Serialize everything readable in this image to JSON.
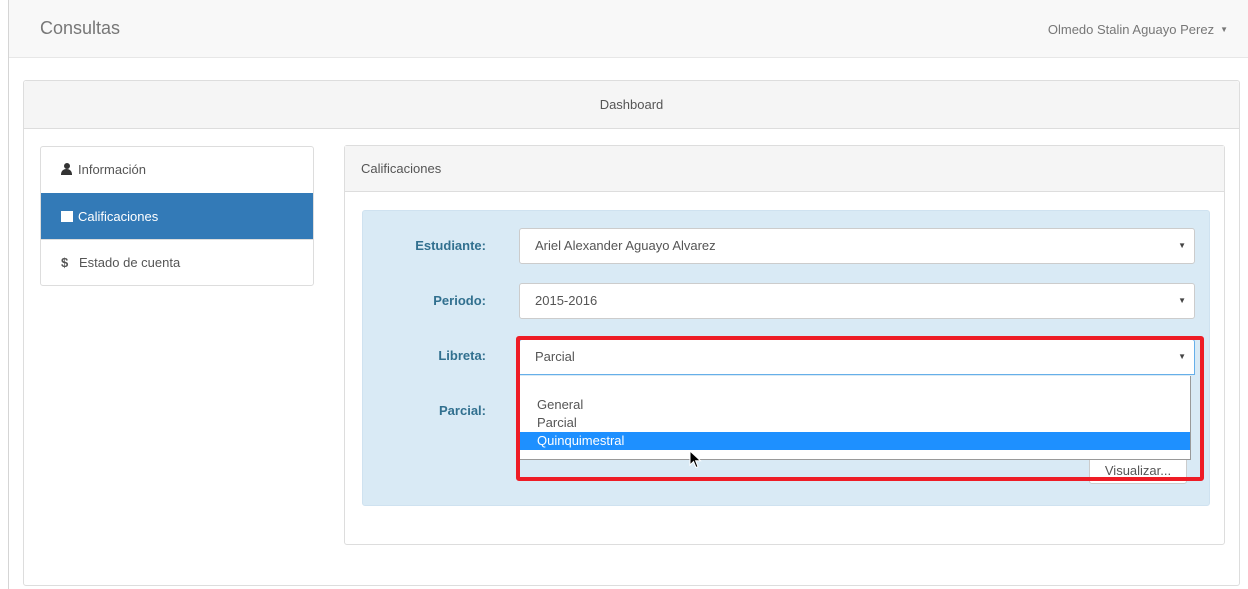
{
  "navbar": {
    "brand": "Consultas",
    "user": "Olmedo Stalin Aguayo Perez",
    "user_caret": "▼"
  },
  "dashboard": {
    "title": "Dashboard"
  },
  "sidebar": {
    "items": [
      {
        "label": "Información",
        "icon": "user-icon",
        "active": false
      },
      {
        "label": "Calificaciones",
        "icon": "table-icon",
        "active": true
      },
      {
        "label": "Estado de cuenta",
        "icon": "dollar-icon",
        "icon_glyph": "$",
        "active": false
      }
    ]
  },
  "calificaciones": {
    "title": "Calificaciones",
    "fields": {
      "estudiante": {
        "label": "Estudiante:",
        "value": "Ariel Alexander Aguayo Alvarez"
      },
      "periodo": {
        "label": "Periodo:",
        "value": "2015-2016"
      },
      "libreta": {
        "label": "Libreta:",
        "value": "Parcial"
      },
      "parcial": {
        "label": "Parcial:"
      }
    },
    "select_arrow": "▼",
    "libreta_options": [
      "General",
      "Parcial",
      "Quinquimestral"
    ],
    "highlighted_option": "Quinquimestral",
    "visualizar_label": "Visualizar..."
  },
  "colors": {
    "active": "#337ab7",
    "highlight_border": "#ee1c25",
    "option_highlight": "#1e90ff",
    "well": "#d9eaf5"
  }
}
